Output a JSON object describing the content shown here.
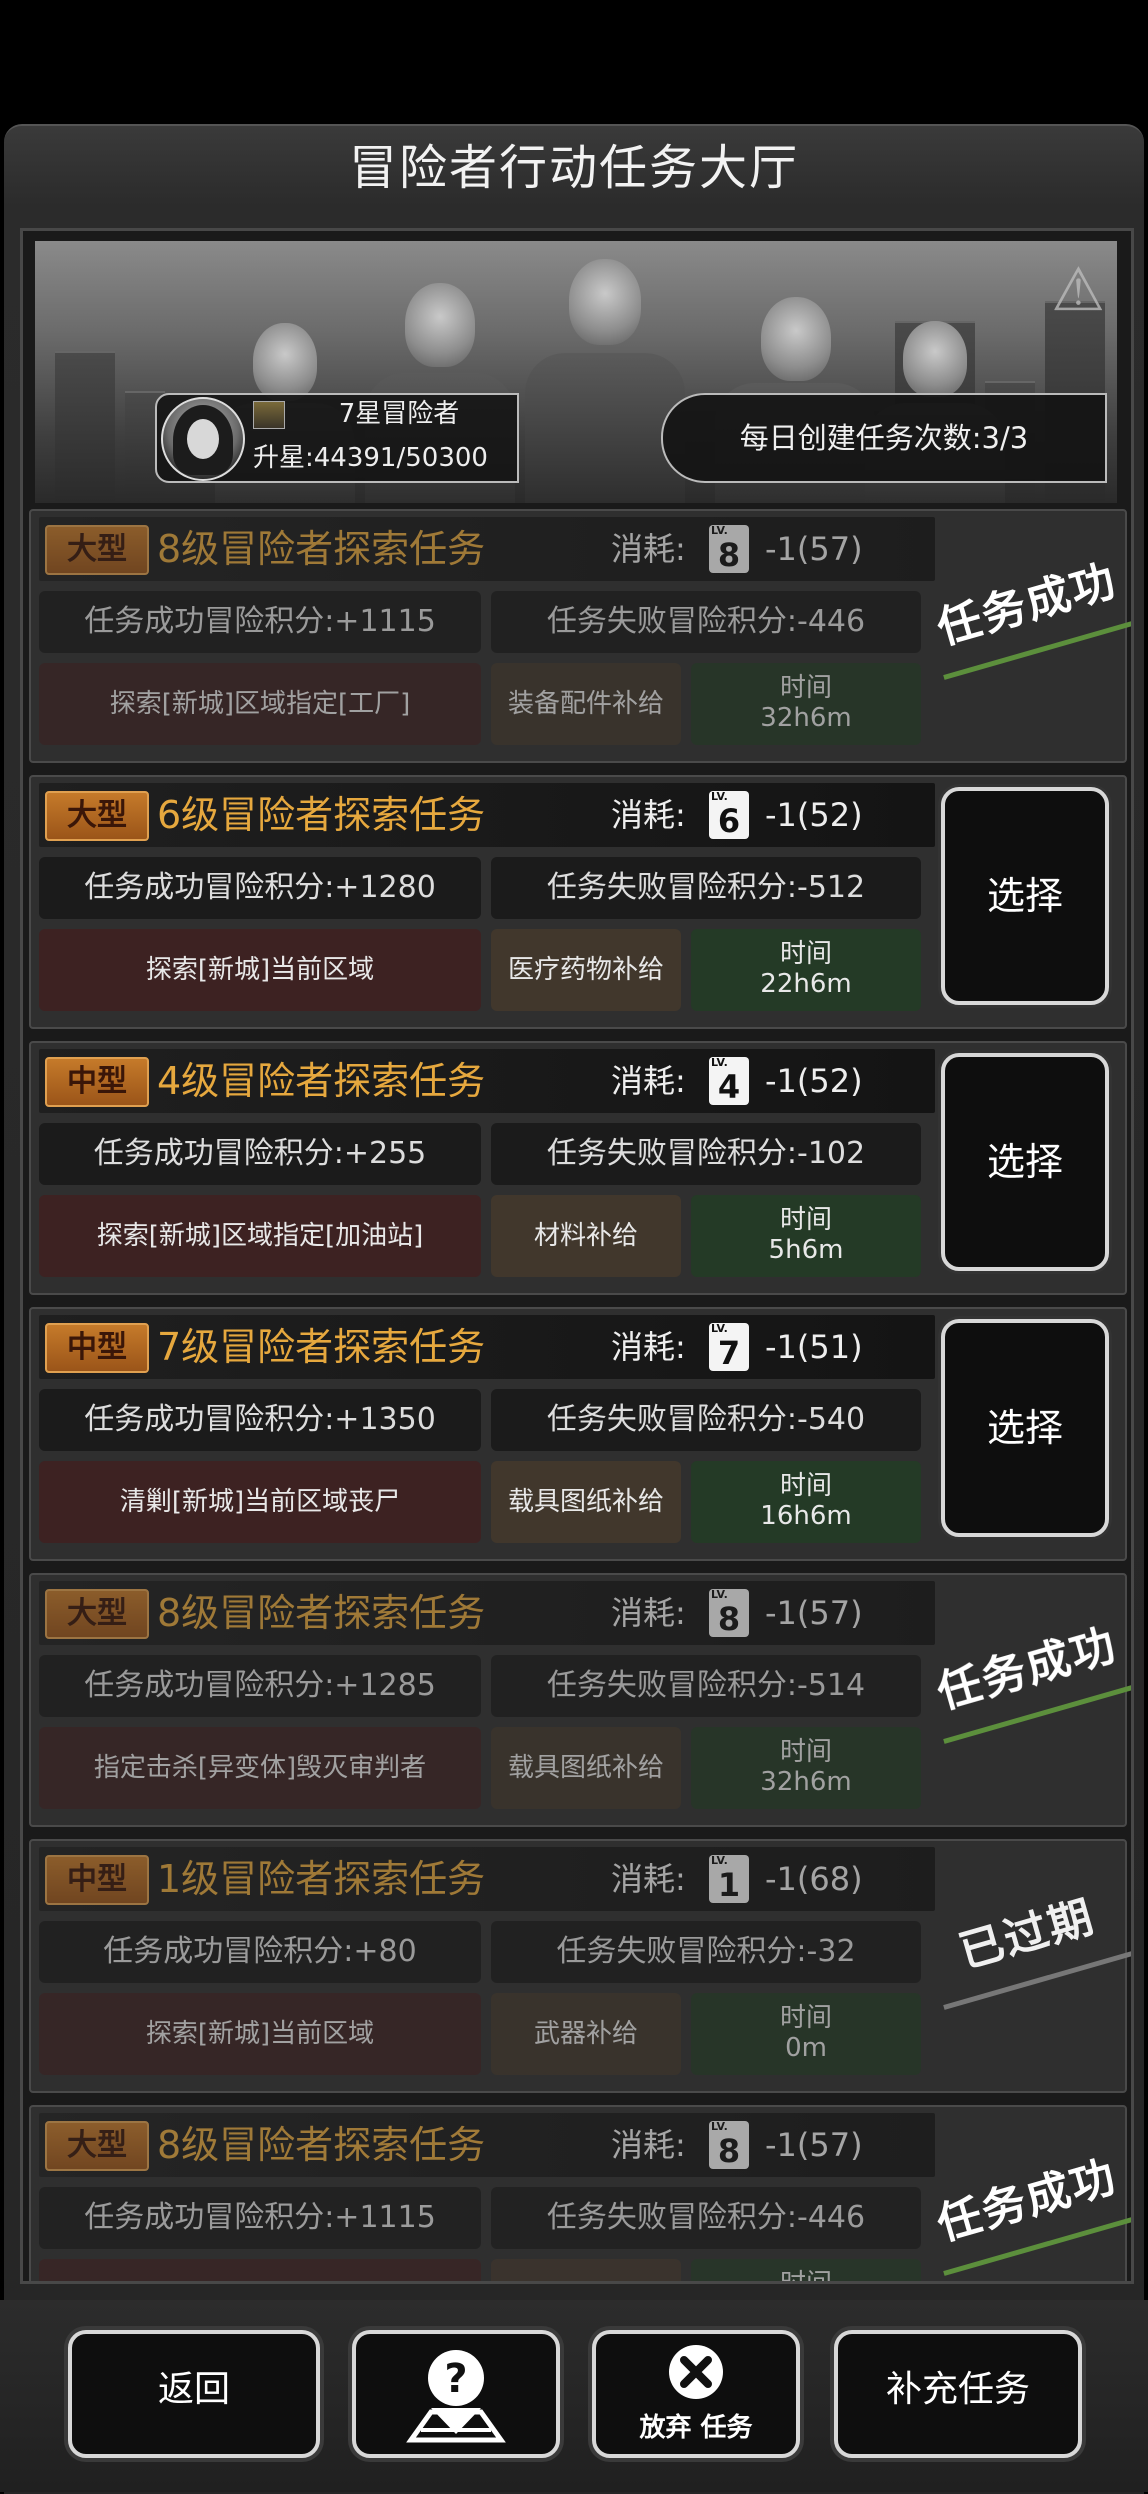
{
  "header": {
    "title": "冒险者行动任务大厅"
  },
  "player": {
    "rank": "7星冒险者",
    "upstar_label": "升星:",
    "upstar_value": "44391/50300"
  },
  "daily": {
    "text": "每日创建任务次数:3/3"
  },
  "cost_label": "消耗:",
  "lv_text": "LV.",
  "time_label": "时间",
  "tasks": [
    {
      "size": "大型",
      "name": "8级冒险者探索任务",
      "level": "8",
      "cost": "-1(57)",
      "success": "任务成功冒险积分:+1115",
      "fail": "任务失败冒险积分:-446",
      "target": "探索[新城]区域指定[工厂]",
      "supply": "装备配件补给",
      "time": "32h6m",
      "status": "任务成功"
    },
    {
      "size": "大型",
      "name": "6级冒险者探索任务",
      "level": "6",
      "cost": "-1(52)",
      "success": "任务成功冒险积分:+1280",
      "fail": "任务失败冒险积分:-512",
      "target": "探索[新城]当前区域",
      "supply": "医疗药物补给",
      "time": "22h6m",
      "action": "选择"
    },
    {
      "size": "中型",
      "name": "4级冒险者探索任务",
      "level": "4",
      "cost": "-1(52)",
      "success": "任务成功冒险积分:+255",
      "fail": "任务失败冒险积分:-102",
      "target": "探索[新城]区域指定[加油站]",
      "supply": "材料补给",
      "time": "5h6m",
      "action": "选择"
    },
    {
      "size": "中型",
      "name": "7级冒险者探索任务",
      "level": "7",
      "cost": "-1(51)",
      "success": "任务成功冒险积分:+1350",
      "fail": "任务失败冒险积分:-540",
      "target": "清剿[新城]当前区域丧尸",
      "supply": "载具图纸补给",
      "time": "16h6m",
      "action": "选择"
    },
    {
      "size": "大型",
      "name": "8级冒险者探索任务",
      "level": "8",
      "cost": "-1(57)",
      "success": "任务成功冒险积分:+1285",
      "fail": "任务失败冒险积分:-514",
      "target": "指定击杀[异变体]毁灭审判者",
      "supply": "载具图纸补给",
      "time": "32h6m",
      "status": "任务成功"
    },
    {
      "size": "中型",
      "name": "1级冒险者探索任务",
      "level": "1",
      "cost": "-1(68)",
      "success": "任务成功冒险积分:+80",
      "fail": "任务失败冒险积分:-32",
      "target": "探索[新城]当前区域",
      "supply": "武器补给",
      "time": "0m",
      "status": "已过期"
    },
    {
      "size": "大型",
      "name": "8级冒险者探索任务",
      "level": "8",
      "cost": "-1(57)",
      "success": "任务成功冒险积分:+1115",
      "fail": "任务失败冒险积分:-446",
      "target": "",
      "supply": "",
      "time": "",
      "status": "任务成功"
    }
  ],
  "footer": {
    "back": "返回",
    "abandon": "放弃 任务",
    "supplement": "补充任务"
  },
  "colors": {
    "accent": "#e6a83e",
    "size_tag": "#c57a2a",
    "success_stripe": "#5c8f3c"
  },
  "icons": {
    "help": "question-map-icon",
    "abandon": "x-circle-icon",
    "emblem": "faction-emblem-icon"
  }
}
